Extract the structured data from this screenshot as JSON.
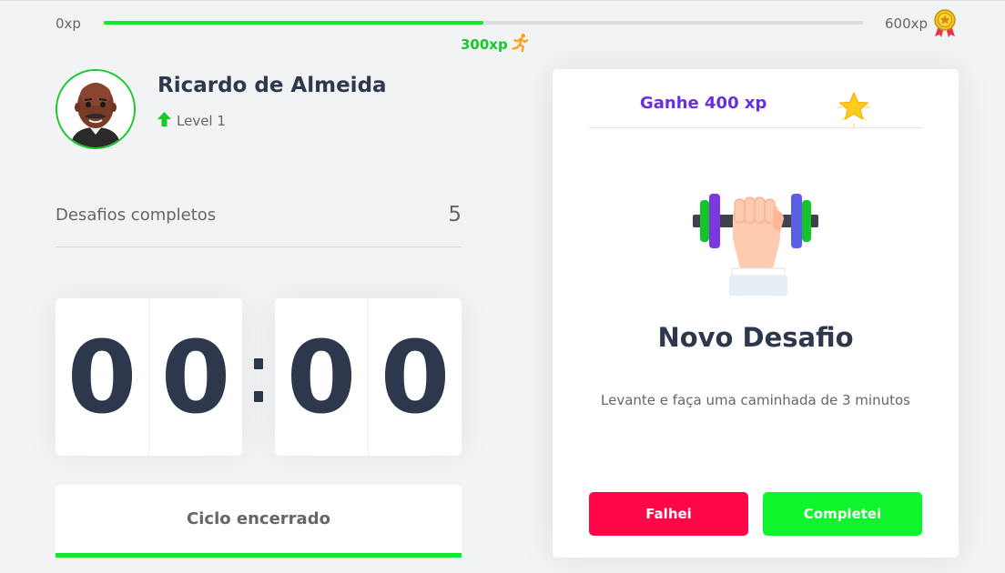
{
  "xp_bar": {
    "min_label": "0xp",
    "max_label": "600xp",
    "current_label": "300xp",
    "progress": 0.5,
    "fill_color": "#0fe82c",
    "icons": {
      "current": "runner-icon",
      "max": "medal-icon"
    }
  },
  "profile": {
    "name": "Ricardo de Almeida",
    "level_label": "Level 1",
    "level_icon": "arrow-up-icon",
    "avatar": "avatar"
  },
  "stats": {
    "completed_label": "Desafios completos",
    "completed_value": "5"
  },
  "countdown": {
    "minute_left": "0",
    "minute_right": "0",
    "second_left": "0",
    "second_right": "0"
  },
  "cycle_button": {
    "label": "Ciclo encerrado",
    "bar_color": "#0fe82c"
  },
  "challenge": {
    "reward": "Ganhe 400 xp",
    "reward_icon": "star-icon",
    "image": "dumbbell-icon",
    "title": "Novo Desafio",
    "description": "Levante e faça uma caminhada de 3 minutos",
    "fail_label": "Falhei",
    "complete_label": "Completei",
    "colors": {
      "fail": "#ff0646",
      "complete": "#0ef52b",
      "reward": "#6a2fde"
    }
  }
}
